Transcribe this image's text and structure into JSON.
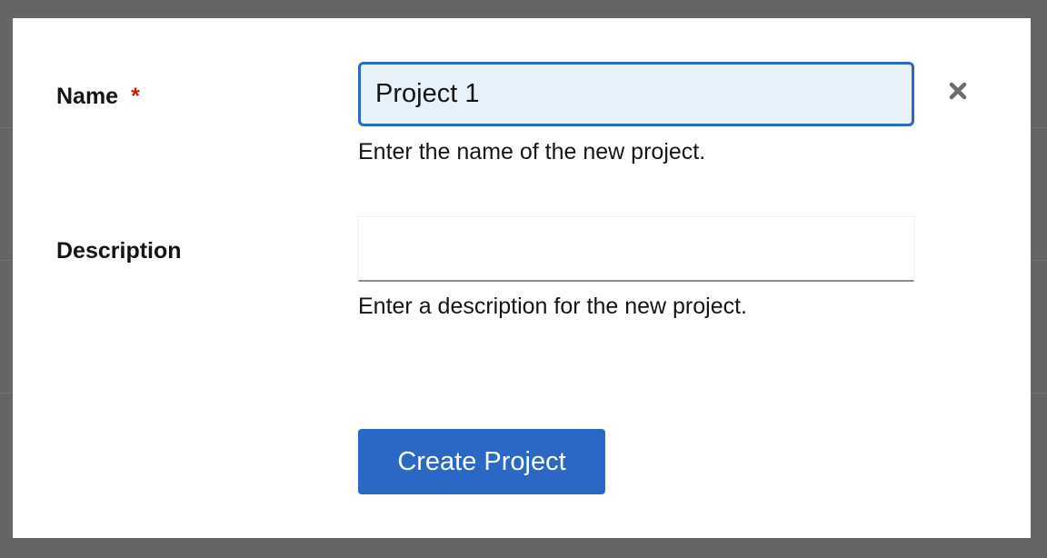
{
  "form": {
    "name_label": "Name",
    "required_marker": "*",
    "name_value": "Project 1",
    "name_helper": "Enter the name of the new project.",
    "description_label": "Description",
    "description_value": "",
    "description_helper": "Enter a description for the new project."
  },
  "actions": {
    "create_label": "Create Project",
    "close_icon": "close-icon"
  },
  "colors": {
    "primary": "#2b67c4",
    "required": "#c9190b",
    "input_focus_bg": "#e7f1fa",
    "backdrop": "#656565",
    "close_icon": "#6a6e73"
  }
}
